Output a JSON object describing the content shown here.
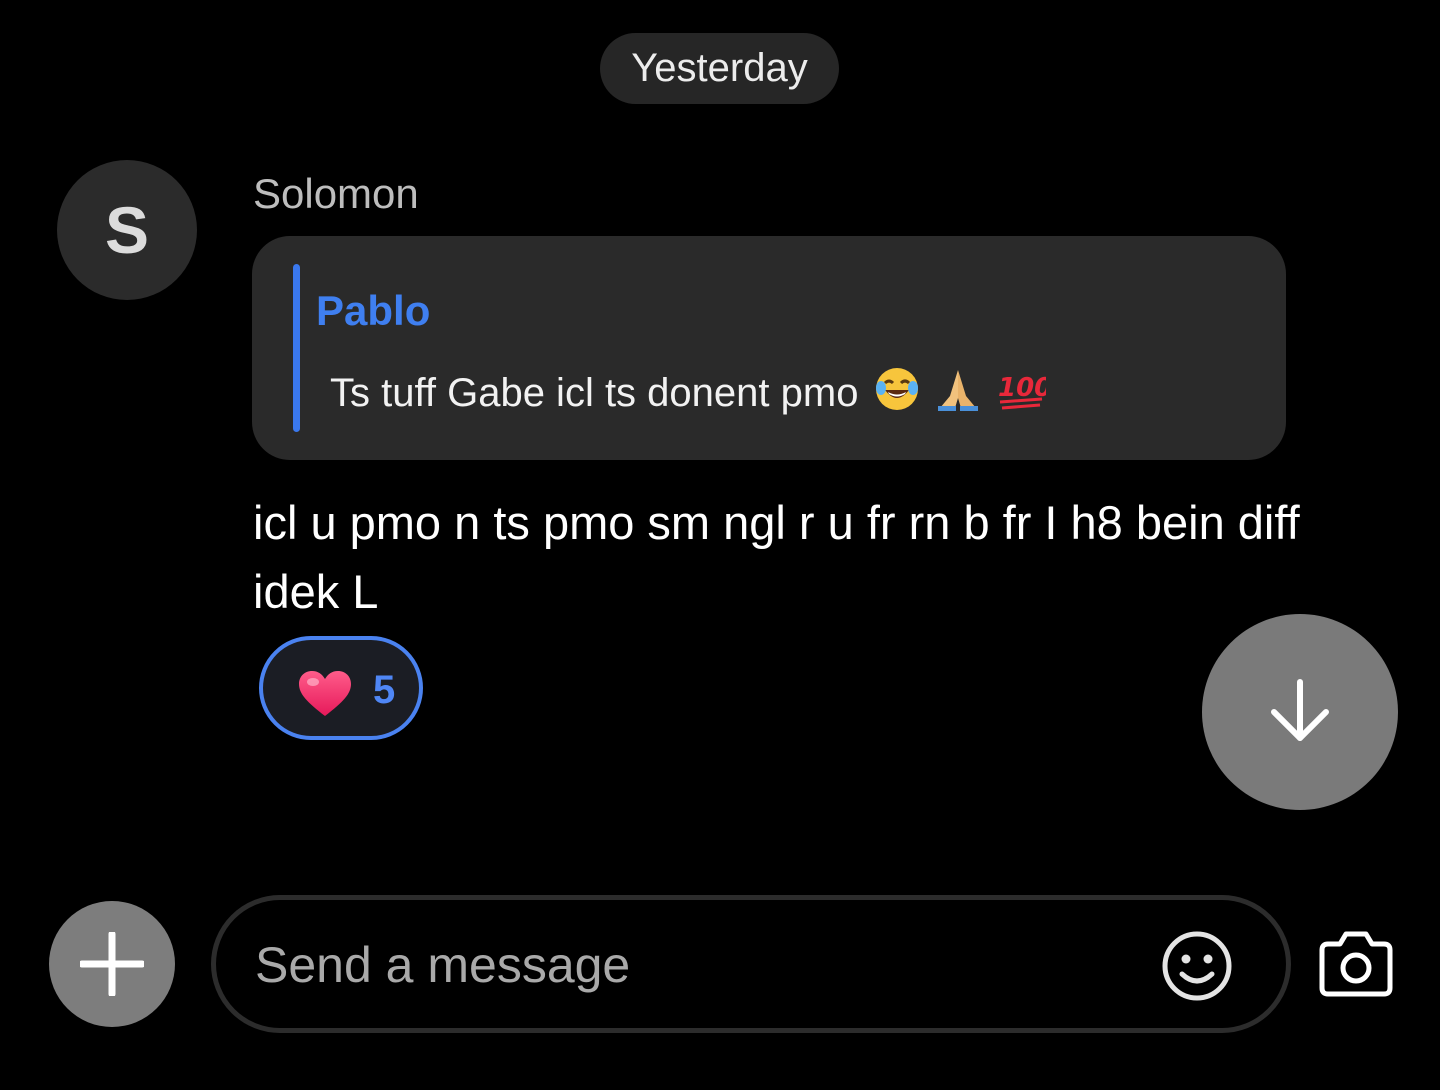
{
  "date_separator": "Yesterday",
  "message": {
    "avatar_initial": "S",
    "sender": "Solomon",
    "reply": {
      "author": "Pablo",
      "text": "Ts tuff Gabe icl ts donent pmo",
      "emojis": [
        "face-with-tears-of-joy-emoji",
        "folded-hands-emoji",
        "hundred-points-emoji"
      ]
    },
    "text": "icl u pmo n ts pmo sm ngl r u fr rn b fr I h8 bein diff idek L",
    "reaction": {
      "emoji": "heart-emoji",
      "count": "5"
    }
  },
  "composer": {
    "placeholder": "Send a message",
    "value": ""
  },
  "icons": {
    "scroll_down": "arrow-down-icon",
    "attach": "plus-icon",
    "emoji": "smiley-icon",
    "camera": "camera-icon"
  },
  "colors": {
    "background": "#000000",
    "accent": "#3f7ff0",
    "bubble": "#2a2a2a",
    "button_gray": "#7a7a7a"
  }
}
